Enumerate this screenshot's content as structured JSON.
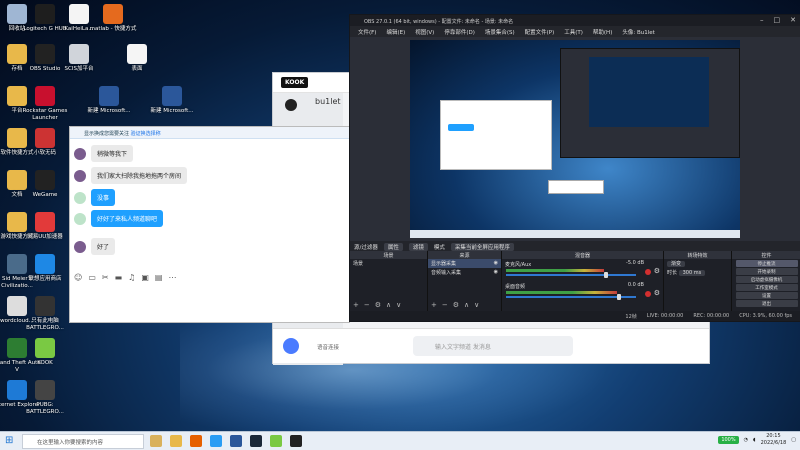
{
  "desktop": {
    "icons": [
      {
        "label": "回收站",
        "color": "#9fb6d3"
      },
      {
        "label": "Logitech G HUB",
        "color": "#1e1e1e"
      },
      {
        "label": "KaiHeiLa...",
        "color": "#f4f4f4"
      },
      {
        "label": "matlab - 快捷方式",
        "color": "#e56a1e"
      },
      {
        "label": "存档",
        "color": "#e8b84a"
      },
      {
        "label": "OBS Studio",
        "color": "#222"
      },
      {
        "label": "SCIS加平台",
        "color": "#d0d4da"
      },
      {
        "label": "表面",
        "color": "#f5f5f5"
      },
      {
        "label": "平台",
        "color": "#e8b84a"
      },
      {
        "label": "Rockstar Games Launcher",
        "color": "#c8102e"
      },
      {
        "label": "新建 Microsoft...",
        "color": "#2b579a"
      },
      {
        "label": "新建 Microsoft...",
        "color": "#2b579a"
      },
      {
        "label": "软件快捷方式",
        "color": "#e8b84a"
      },
      {
        "label": "小软无码",
        "color": "#c33"
      },
      {
        "label": "文档",
        "color": "#e8b84a"
      },
      {
        "label": "WeGame",
        "color": "#222"
      },
      {
        "label": "游戏快捷方式",
        "color": "#e8b84a"
      },
      {
        "label": "网易UU加速器",
        "color": "#e23a3a"
      },
      {
        "label": "Sid Meier's Civilizatio...",
        "color": "#4a6b8a"
      },
      {
        "label": "联想应用商店",
        "color": "#1e88e5"
      },
      {
        "label": "wordcloud...",
        "color": "#ddd"
      },
      {
        "label": "只有此电脑 BATTLEGRO...",
        "color": "#333"
      },
      {
        "label": "Grand Theft Auto V",
        "color": "#2d7d32"
      },
      {
        "label": "KOOK",
        "color": "#7ac943"
      },
      {
        "label": "Internet Explorer",
        "color": "#1e7ad6"
      },
      {
        "label": "PUBG: BATTLEGRO...",
        "color": "#444"
      }
    ]
  },
  "kook": {
    "logo": "KOOK",
    "username": "bu1let",
    "input_placeholder": "输入文字频道 发消息",
    "status": "语音连接"
  },
  "chat": {
    "notice": "显示换成您需要关注",
    "notice_link": "验证换选择称",
    "messages": [
      {
        "text": "稍微等我下",
        "style": "gray",
        "avatar": "purple"
      },
      {
        "text": "我们家大扫除我拖地拖两个房间",
        "style": "gray",
        "avatar": "purple"
      },
      {
        "text": "没事",
        "style": "blue",
        "avatar": "green"
      },
      {
        "text": "好好了来私人频道聊吧",
        "style": "blue",
        "avatar": "green"
      },
      {
        "text": "好了",
        "style": "gray",
        "avatar": "purple"
      }
    ]
  },
  "obs": {
    "title": "OBS 27.0.1 (64 bit, windows) - 配置文件: 未命名 - 场景: 未命名",
    "menu": [
      "文件(F)",
      "编辑(E)",
      "视图(V)",
      "停靠部件(D)",
      "场景集合(S)",
      "配置文件(P)",
      "工具(T)",
      "帮助(H)",
      "头像: Bu1let"
    ],
    "source_bar": {
      "label": "源/过滤器",
      "btn_properties": "属性",
      "btn_filters": "滤镜",
      "mode_label": "模式",
      "mode_value": "采集当前全屏应用程序"
    },
    "docks": {
      "scenes": {
        "header": "场景",
        "items": [
          "场景"
        ]
      },
      "sources": {
        "header": "来源",
        "items": [
          "显示器采集",
          "音频输入采集"
        ]
      },
      "mixer": {
        "header": "混音器",
        "tracks": [
          {
            "name": "麦克风/Aux",
            "db": "-5.0 dB",
            "level": 0.75
          },
          {
            "name": "桌面音频",
            "db": "0.0 dB",
            "level": 0.85
          }
        ]
      },
      "transitions": {
        "header": "转场特效",
        "type": "渐变",
        "duration_label": "时长",
        "duration_value": "300 ms"
      },
      "controls": {
        "header": "控件",
        "buttons": [
          "停止推流",
          "开始录制",
          "启动虚拟摄像机",
          "工作室模式",
          "设置",
          "退出"
        ]
      }
    },
    "status": {
      "drop": "12帧",
      "live": "LIVE: 00:00:00",
      "rec": "REC: 00:00:00",
      "cpu": "CPU: 3.9%, 60.00 fps"
    }
  },
  "taskbar": {
    "search_placeholder": "在这里输入你要搜索的内容",
    "battery": "100%",
    "time": "20:15",
    "date": "2022/6/18"
  }
}
